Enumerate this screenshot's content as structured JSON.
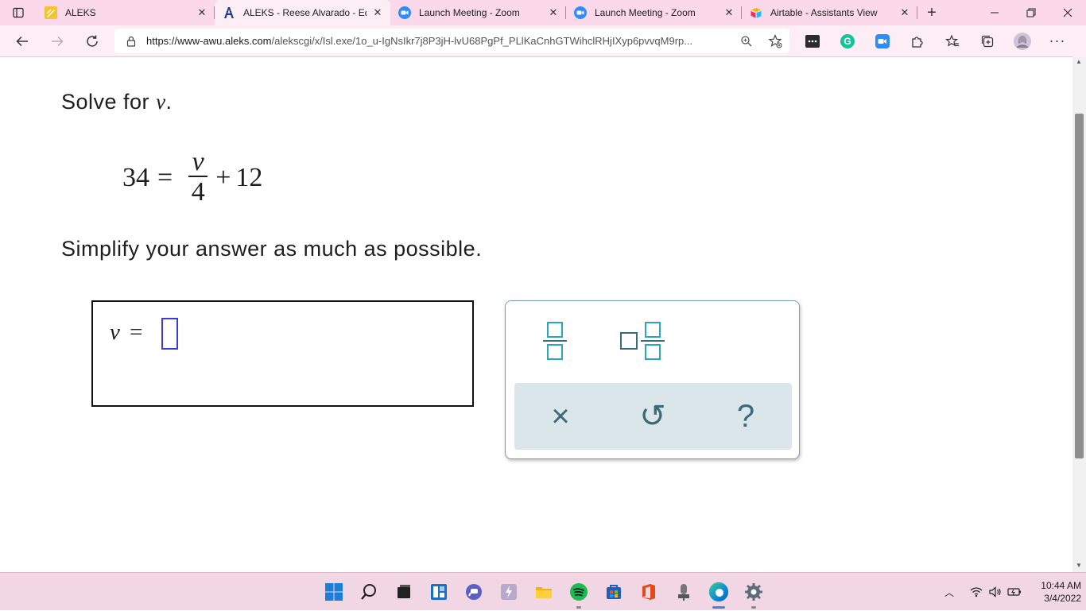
{
  "browser": {
    "tabs": [
      {
        "title": "ALEKS",
        "icon": "aleks-pencil-icon"
      },
      {
        "title": "ALEKS - Reese Alvarado - Eq",
        "icon": "aleks-a-icon"
      },
      {
        "title": "Launch Meeting - Zoom",
        "icon": "zoom-icon"
      },
      {
        "title": "Launch Meeting - Zoom",
        "icon": "zoom-icon"
      },
      {
        "title": "Airtable - Assistants View",
        "icon": "airtable-icon"
      }
    ],
    "active_tab_index": 1,
    "url_host": "https://www-awu.aleks.com",
    "url_path": "/alekscgi/x/Isl.exe/1o_u-IgNsIkr7j8P3jH-lvU68PgPf_PLlKaCnhGTWihclRHjIXyp6pvvqM9rp..."
  },
  "problem": {
    "prompt_prefix": "Solve for ",
    "prompt_var": "v",
    "prompt_suffix": ".",
    "equation": {
      "lhs": "34",
      "equals": "=",
      "numerator": "v",
      "denominator": "4",
      "plus": "+",
      "constant": "12"
    },
    "instruction": "Simplify your answer as much as possible."
  },
  "answer": {
    "variable": "v",
    "equals": "=",
    "value": ""
  },
  "keypad": {
    "buttons": [
      "fraction-button",
      "mixed-number-button"
    ],
    "actions": {
      "clear": "×",
      "undo": "↺",
      "help": "?"
    },
    "accent_color": "#2aa7b8",
    "action_color": "#3b6a79"
  },
  "taskbar": {
    "icons": [
      "windows-start-icon",
      "search-icon",
      "task-view-icon",
      "widgets-icon",
      "teams-chat-icon",
      "app-icon",
      "file-explorer-icon",
      "spotify-icon",
      "microsoft-store-icon",
      "office-icon",
      "microphone-app-icon",
      "edge-icon",
      "settings-icon"
    ],
    "time": "10:44 AM",
    "date": "3/4/2022"
  },
  "colors": {
    "tabstrip": "#fbd8ea",
    "toolbar": "#fdeef6",
    "answer_slot": "#3a3ad6"
  }
}
